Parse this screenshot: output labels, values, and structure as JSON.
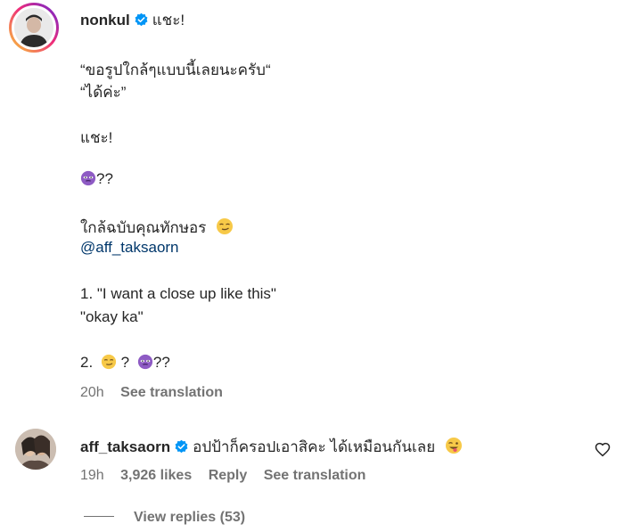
{
  "post": {
    "username": "nonkul",
    "caption_first": "แชะ!",
    "lines": [
      "“ขอรูปใกล้ๆแบบนี้เลยนะครับ“",
      "“ได้ค่ะ”",
      "แชะ!",
      "??",
      "ใกล้ฉบับคุณทักษอร",
      "@aff_taksaorn",
      "1. \"I want a close up like this\"",
      "\"okay ka\"",
      "2.",
      "?",
      "??"
    ],
    "time": "20h",
    "see_translation": "See translation"
  },
  "comment": {
    "username": "aff_taksaorn",
    "text": "อปป้าก็ครอปเอาสิคะ ได้เหมือนกันเลย",
    "time": "19h",
    "likes": "3,926 likes",
    "reply": "Reply",
    "see_translation": "See translation",
    "view_replies": "View replies (53)"
  },
  "colors": {
    "verified": "#0095f6",
    "mention": "#00376b",
    "secondary_text": "#737373",
    "primary_text": "#262626"
  },
  "icons": [
    "verified-badge-icon",
    "purple-face-emoji-icon",
    "smirk-emoji-icon",
    "tongue-wink-emoji-icon",
    "heart-outline-icon"
  ]
}
